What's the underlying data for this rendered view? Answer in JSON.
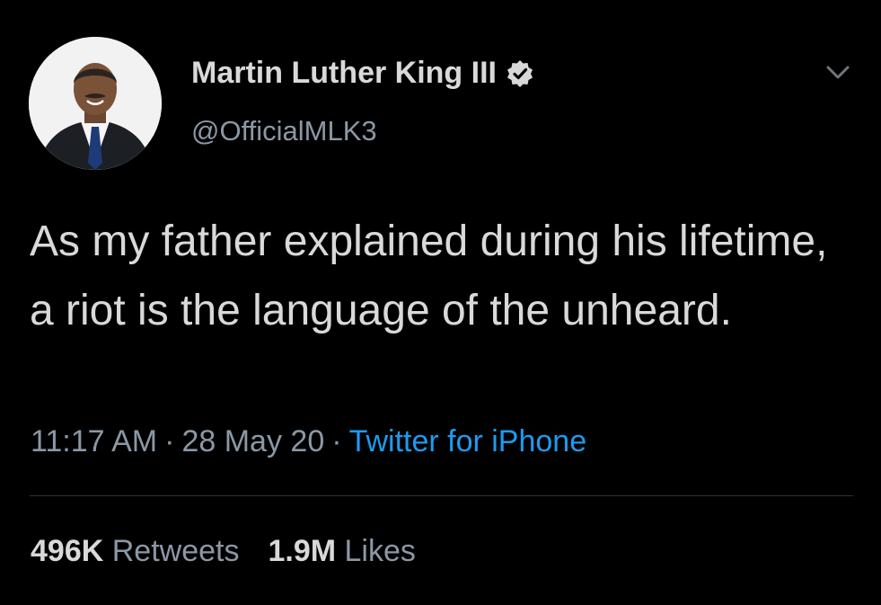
{
  "author": {
    "display_name": "Martin Luther King III",
    "handle": "@OfficialMLK3",
    "verified_icon": "verified-badge-icon"
  },
  "tweet": {
    "text": "As my father explained during his lifetime, a riot is the language of the unheard."
  },
  "meta": {
    "time": "11:17 AM",
    "separator": "·",
    "date": "28 May 20",
    "source": "Twitter for iPhone"
  },
  "stats": {
    "retweets_count": "496K",
    "retweets_label": "Retweets",
    "likes_count": "1.9M",
    "likes_label": "Likes"
  },
  "colors": {
    "background": "#000000",
    "text": "#d9d9d9",
    "secondary": "#8b98a5",
    "link": "#1d9bf0"
  }
}
